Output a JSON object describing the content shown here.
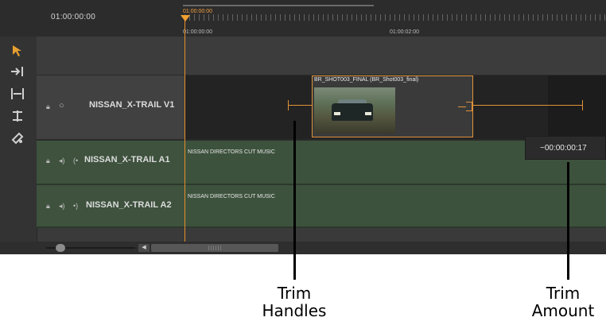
{
  "ruler": {
    "timecode_left": "01:00:00:00",
    "playhead_timecode": "01:00:00:00",
    "tick_labels": [
      "01:00:00:00",
      "01:00:02:00"
    ]
  },
  "tools": [
    "select-tool-icon",
    "track-select-icon",
    "ripple-edit-icon",
    "rolling-edit-icon",
    "razor-tool-icon"
  ],
  "tracks": {
    "v1": {
      "name": "NISSAN_X-TRAIL V1"
    },
    "a1": {
      "name": "NISSAN_X-TRAIL A1",
      "clip_label": "NISSAN DIRECTORS CUT MUSIC"
    },
    "a2": {
      "name": "NISSAN_X-TRAIL A2",
      "clip_label": "NISSAN DIRECTORS CUT MUSIC"
    }
  },
  "clip": {
    "label": "BR_SHOT003_FINAL (BR_Shot003_final)"
  },
  "trim_amount": "−00:00:00:17",
  "callouts": {
    "trim_handles": {
      "line1": "Trim",
      "line2": "Handles"
    },
    "trim_amount": {
      "line1": "Trim",
      "line2": "Amount"
    }
  },
  "colors": {
    "accent": "#e0923a",
    "audio_track": "#3e523e",
    "playhead": "#e8902c"
  }
}
